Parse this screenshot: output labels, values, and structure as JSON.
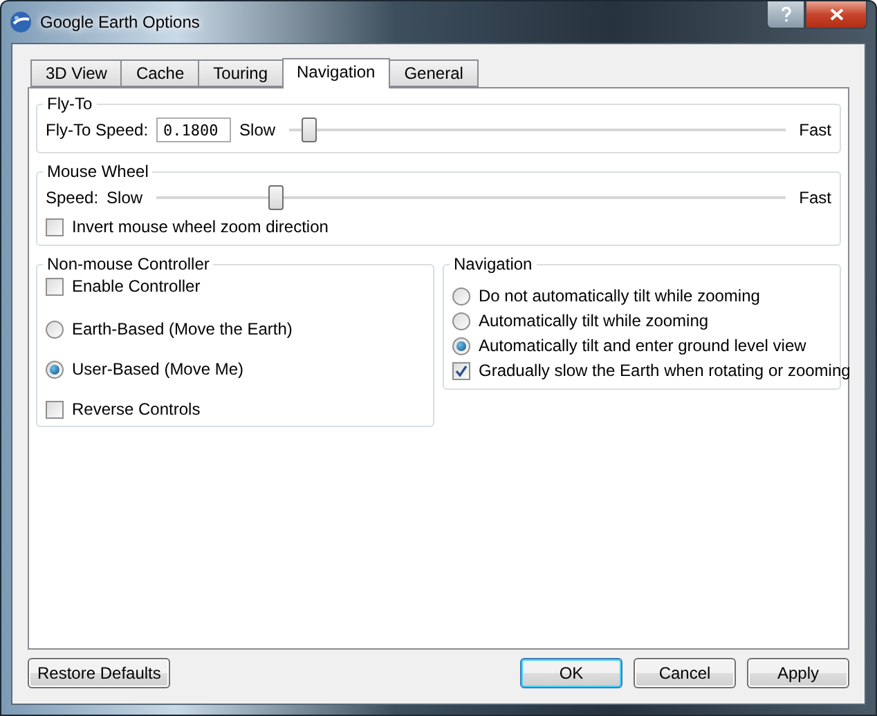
{
  "window": {
    "title": "Google Earth Options"
  },
  "tabs": [
    {
      "label": "3D View",
      "selected": false
    },
    {
      "label": "Cache",
      "selected": false
    },
    {
      "label": "Touring",
      "selected": false
    },
    {
      "label": "Navigation",
      "selected": true
    },
    {
      "label": "General",
      "selected": false
    }
  ],
  "fly_to": {
    "title": "Fly-To",
    "speed_label": "Fly-To Speed:",
    "speed_value": "0.1800",
    "slow_label": "Slow",
    "level": 0.04,
    "fast_label": "Fast"
  },
  "mouse_wheel": {
    "title": "Mouse Wheel",
    "speed_label": "Speed:",
    "slow_label": "Slow",
    "level": 0.19,
    "fast_label": "Fast",
    "invert": {
      "label": "Invert mouse wheel zoom direction",
      "checked": false
    }
  },
  "controller": {
    "title": "Non-mouse Controller",
    "options": [
      {
        "kind": "checkbox",
        "label": "Enable Controller",
        "checked": false
      },
      {
        "kind": "radio",
        "label": "Earth-Based (Move the Earth)",
        "selected": false
      },
      {
        "kind": "radio",
        "label": "User-Based (Move Me)",
        "selected": true
      },
      {
        "kind": "checkbox",
        "label": "Reverse Controls",
        "checked": false
      }
    ]
  },
  "navigation": {
    "title": "Navigation",
    "options": [
      {
        "kind": "radio",
        "label": "Do not automatically tilt while zooming",
        "selected": false
      },
      {
        "kind": "radio",
        "label": "Automatically tilt while zooming",
        "selected": false
      },
      {
        "kind": "radio",
        "label": "Automatically tilt and enter ground level view",
        "selected": true
      },
      {
        "kind": "checkbox",
        "label": "Gradually slow the Earth when rotating or zooming",
        "checked": true
      }
    ]
  },
  "footer": {
    "restore_label": "Restore Defaults",
    "buttons": [
      {
        "label": "OK",
        "default": true
      },
      {
        "label": "Cancel",
        "default": false
      },
      {
        "label": "Apply",
        "default": false
      }
    ]
  }
}
